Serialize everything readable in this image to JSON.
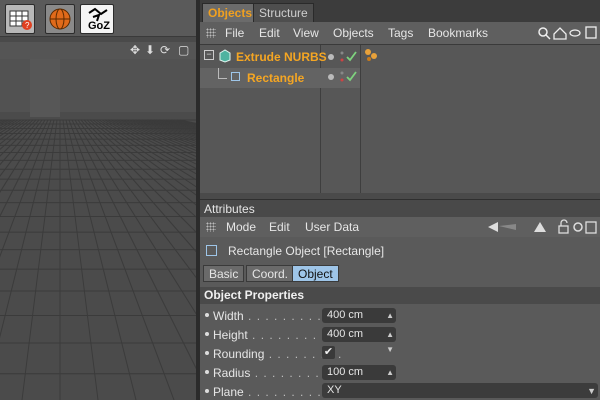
{
  "toolbar": {
    "buttons": [
      {
        "name": "table-icon"
      },
      {
        "name": "sphere-icon"
      },
      {
        "name": "goz-button",
        "label": "GoZ"
      }
    ]
  },
  "viewport": {
    "header_icons": [
      "move-icon",
      "arrow-down-icon",
      "rotate-icon",
      "maximize-icon"
    ]
  },
  "panel_tabs": [
    {
      "label": "Objects",
      "active": true
    },
    {
      "label": "Structure",
      "active": false
    }
  ],
  "object_menu": [
    "File",
    "Edit",
    "View",
    "Objects",
    "Tags",
    "Bookmarks"
  ],
  "objects": [
    {
      "name": "Extrude NURBS"
    },
    {
      "name": "Rectangle"
    }
  ],
  "attributes": {
    "title": "Attributes",
    "menu": [
      "Mode",
      "Edit",
      "User Data"
    ],
    "object_title": "Rectangle Object [Rectangle]",
    "tabs": [
      {
        "label": "Basic",
        "active": false
      },
      {
        "label": "Coord.",
        "active": false
      },
      {
        "label": "Object",
        "active": true
      }
    ],
    "section": "Object Properties",
    "properties": [
      {
        "label": "Width",
        "dots": " . . . . . . . . . . . .",
        "value": "400 cm"
      },
      {
        "label": "Height",
        "dots": " . . . . . . . . . . . .",
        "value": "400 cm"
      },
      {
        "label": "Rounding",
        "dots": " . . . . . . . . .",
        "value": "✔"
      },
      {
        "label": "Radius",
        "dots": " . . . . . . . . . . .",
        "value": "100 cm"
      },
      {
        "label": "Plane",
        "dots": " . . . . . . . . . . . .",
        "value": "XY"
      }
    ]
  },
  "colors": {
    "accent": "#f5a623",
    "selected_tab": "#9ec5e8",
    "check": "#7ed27e"
  }
}
